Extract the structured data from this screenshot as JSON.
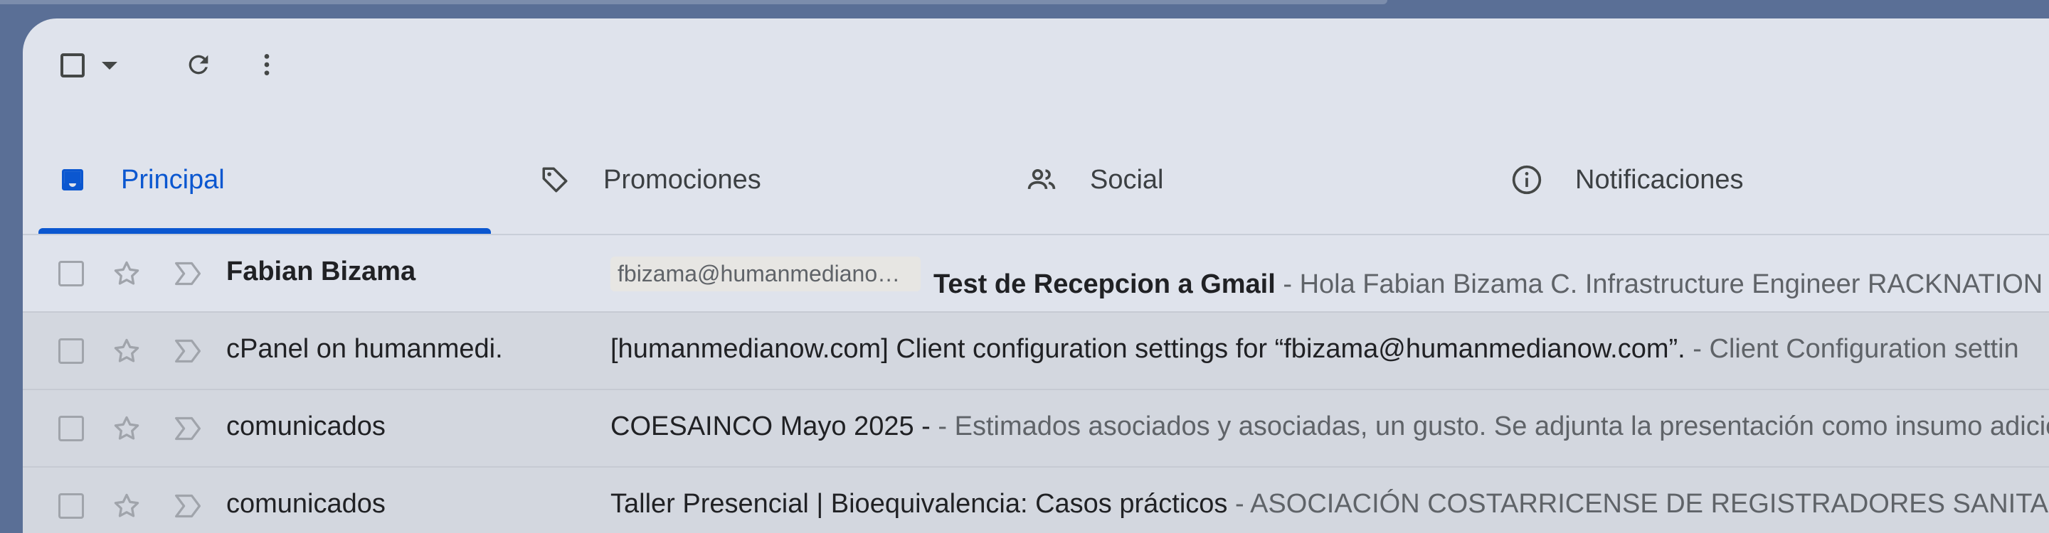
{
  "toolbar": {
    "select_icon": "checkbox-icon",
    "select_menu_icon": "caret-down-icon",
    "refresh_icon": "refresh-icon",
    "more_icon": "more-vert-icon"
  },
  "tabs": [
    {
      "label": "Principal",
      "icon": "inbox-icon",
      "active": true
    },
    {
      "label": "Promociones",
      "icon": "tag-icon",
      "active": false
    },
    {
      "label": "Social",
      "icon": "people-icon",
      "active": false
    },
    {
      "label": "Notificaciones",
      "icon": "info-icon",
      "active": false
    }
  ],
  "colors": {
    "accent": "#0b57d0",
    "panel_bg": "#dfe3ec",
    "read_row_bg": "#d3d7df",
    "page_bg": "#5a6f96"
  },
  "emails": [
    {
      "sender": "Fabian Bizama",
      "chip": "fbizama@humanmedianow.c...",
      "subject": "Test de Recepcion a Gmail",
      "snippet": " - Hola Fabian Bizama C. Infrastructure Engineer RACKNATION",
      "unread": true
    },
    {
      "sender": "cPanel on humanmedi.",
      "chip": "",
      "subject": "[humanmedianow.com] Client configuration settings for “fbizama@humanmedianow.com”.",
      "snippet": " - Client Configuration settin",
      "unread": false
    },
    {
      "sender": "comunicados",
      "chip": "",
      "subject": "COESAINCO Mayo 2025 -",
      "snippet": " - Estimados asociados y asociadas, un gusto. Se adjunta la presentación como insumo adicio",
      "unread": false
    },
    {
      "sender": "comunicados",
      "chip": "",
      "subject": "Taller Presencial | Bioequivalencia: Casos prácticos",
      "snippet": " - ASOCIACIÓN COSTARRICENSE DE REGISTRADORES SANITARIOS",
      "unread": false
    }
  ]
}
